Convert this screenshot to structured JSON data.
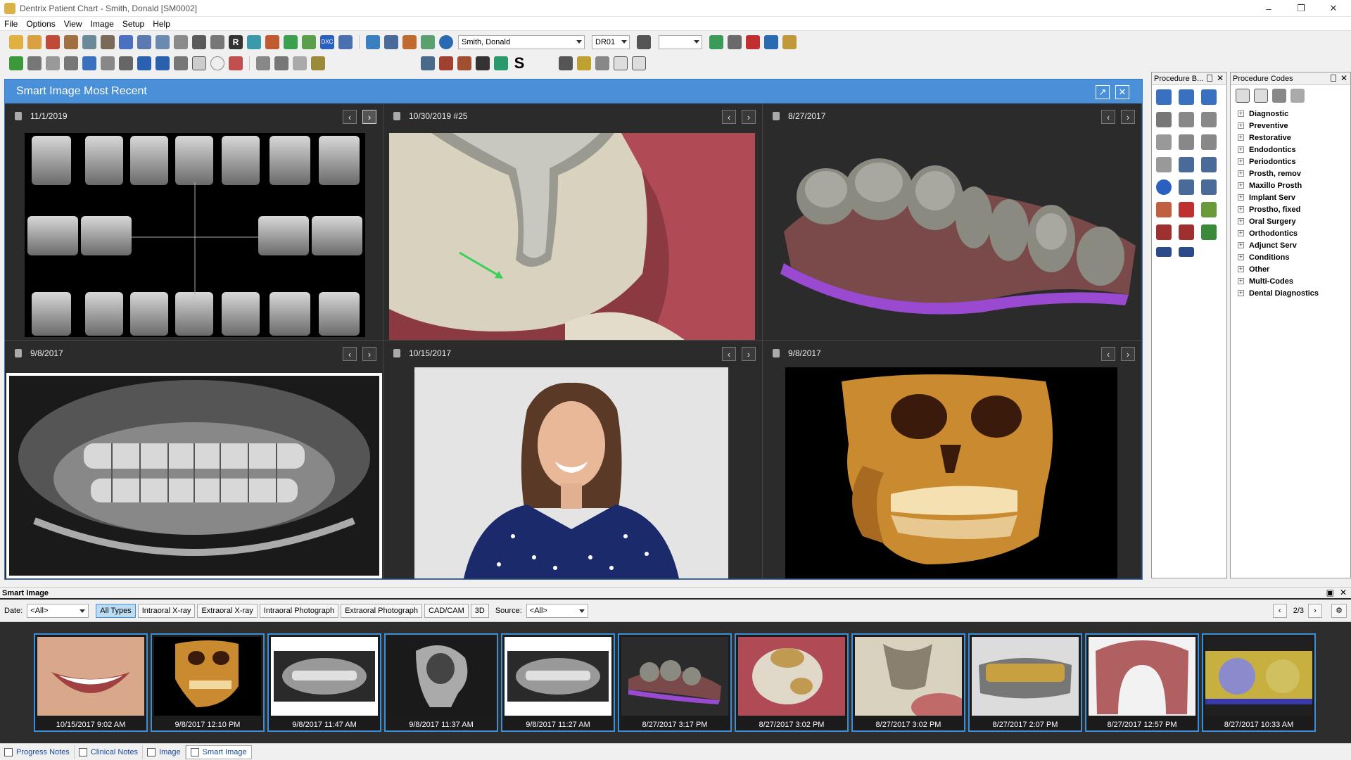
{
  "window": {
    "title": "Dentrix Patient Chart - Smith, Donald [SM0002]"
  },
  "menu": [
    "File",
    "Options",
    "View",
    "Image",
    "Setup",
    "Help"
  ],
  "toolbar": {
    "patient_name": "Smith, Donald",
    "provider": "DR01",
    "blank_combo": ""
  },
  "smart_panel": {
    "title": "Smart Image Most Recent",
    "cells": [
      {
        "date": "11/1/2019",
        "kind": "fmx"
      },
      {
        "date": "10/30/2019 #25",
        "kind": "intraoral-photo"
      },
      {
        "date": "8/27/2017",
        "kind": "3d-scan"
      },
      {
        "date": "9/8/2017",
        "kind": "panoramic"
      },
      {
        "date": "10/15/2017",
        "kind": "portrait"
      },
      {
        "date": "9/8/2017",
        "kind": "cbct"
      }
    ]
  },
  "procedure_buttons": {
    "title": "Procedure B..."
  },
  "procedure_codes": {
    "title": "Procedure Codes",
    "items": [
      "Diagnostic",
      "Preventive",
      "Restorative",
      "Endodontics",
      "Periodontics",
      "Prosth, remov",
      "Maxillo Prosth",
      "Implant Serv",
      "Prostho, fixed",
      "Oral Surgery",
      "Orthodontics",
      "Adjunct Serv",
      "Conditions",
      "Other",
      "Multi-Codes",
      "Dental Diagnostics"
    ]
  },
  "smart_image": {
    "title": "Smart Image",
    "date_label": "Date:",
    "date_value": "<All>",
    "types": [
      "All Types",
      "Intraoral X-ray",
      "Extraoral X-ray",
      "Intraoral Photograph",
      "Extraoral Photograph",
      "CAD/CAM",
      "3D"
    ],
    "source_label": "Source:",
    "source_value": "<All>",
    "page": "2/3",
    "thumbnails": [
      {
        "caption": "10/15/2017 9:02 AM"
      },
      {
        "caption": "9/8/2017 12:10 PM"
      },
      {
        "caption": "9/8/2017 11:47 AM"
      },
      {
        "caption": "9/8/2017 11:37 AM"
      },
      {
        "caption": "9/8/2017 11:27 AM"
      },
      {
        "caption": "8/27/2017 3:17 PM"
      },
      {
        "caption": "8/27/2017 3:02 PM"
      },
      {
        "caption": "8/27/2017 3:02 PM"
      },
      {
        "caption": "8/27/2017 2:07 PM"
      },
      {
        "caption": "8/27/2017 12:57 PM"
      },
      {
        "caption": "8/27/2017 10:33 AM"
      }
    ]
  },
  "tabs": [
    "Progress Notes",
    "Clinical Notes",
    "Image",
    "Smart Image"
  ],
  "colors": {
    "accent": "#4a90d9",
    "thumb_border": "#3b8fd9",
    "dark_bg": "#2d2d2d"
  }
}
